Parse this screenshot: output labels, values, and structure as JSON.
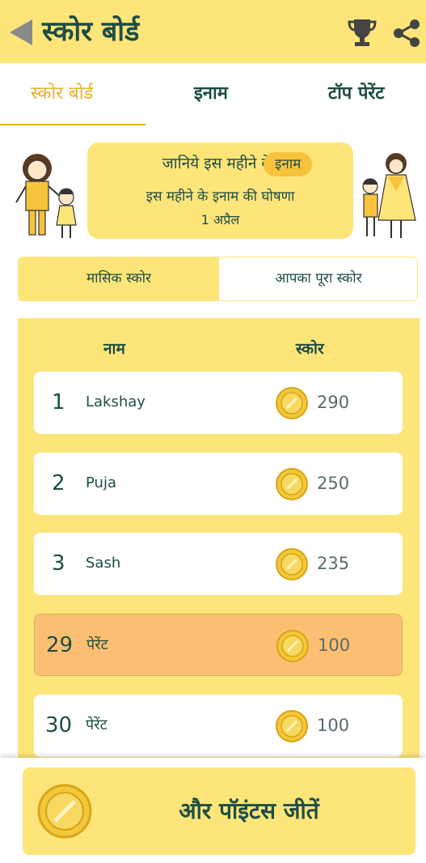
{
  "header": {
    "title": "स्कोर बोर्ड",
    "back_icon": "back-arrow-icon",
    "trophy_icon": "trophy-icon",
    "share_icon": "share-icon"
  },
  "tabs": [
    {
      "label": "स्कोर बोर्ड",
      "active": true
    },
    {
      "label": "इनाम",
      "active": false
    },
    {
      "label": "टॉप पेरेंट",
      "active": false
    }
  ],
  "banner": {
    "line1": "जानिये इस महीने के",
    "pill": "इनाम",
    "line2": "इस महीने के इनाम की घोषणा",
    "line3": "1 अप्रैल"
  },
  "segments": [
    {
      "label": "मासिक स्कोर",
      "active": true
    },
    {
      "label": "आपका पूरा स्कोर",
      "active": false
    }
  ],
  "table": {
    "col_name": "नाम",
    "col_score": "स्कोर",
    "rows": [
      {
        "rank": "1",
        "name": "Lakshay",
        "score": "290",
        "highlight": false
      },
      {
        "rank": "2",
        "name": "Puja",
        "score": "250",
        "highlight": false
      },
      {
        "rank": "3",
        "name": "Sash",
        "score": "235",
        "highlight": false
      },
      {
        "rank": "29",
        "name": "पेरेंट",
        "score": "100",
        "highlight": true
      },
      {
        "rank": "30",
        "name": "पेरेंट",
        "score": "100",
        "highlight": false
      }
    ]
  },
  "cta": {
    "label": "और पॉइंटस जीतें",
    "icon": "coin-icon"
  },
  "colors": {
    "primary_yellow": "#fde57a",
    "accent_gold": "#e6b12f",
    "highlight_orange": "#fbbf73",
    "text_dark_green": "#1f4d45"
  }
}
